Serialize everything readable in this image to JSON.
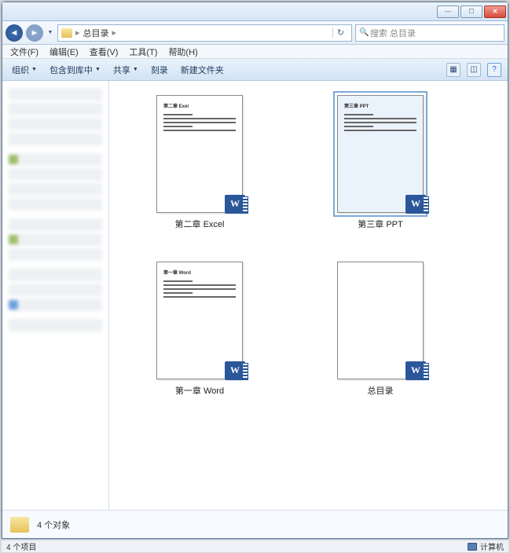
{
  "address": {
    "folder": "总目录"
  },
  "search": {
    "placeholder": "搜索 总目录"
  },
  "menu": {
    "file": "文件(F)",
    "edit": "编辑(E)",
    "view": "查看(V)",
    "tools": "工具(T)",
    "help": "帮助(H)"
  },
  "cmd": {
    "organize": "组织",
    "include": "包含到库中",
    "share": "共享",
    "burn": "刻录",
    "newfolder": "新建文件夹"
  },
  "files": {
    "f0": {
      "name": "第二章 Excel",
      "head": "第二章  Exel"
    },
    "f1": {
      "name": "第三章 PPT",
      "head": "第三章  PPT"
    },
    "f2": {
      "name": "第一章 Word",
      "head": "第一章  Word"
    },
    "f3": {
      "name": "总目录",
      "head": ""
    }
  },
  "details": {
    "count": "4 个对象"
  },
  "status": {
    "left": "4 个项目",
    "right": "计算机"
  }
}
